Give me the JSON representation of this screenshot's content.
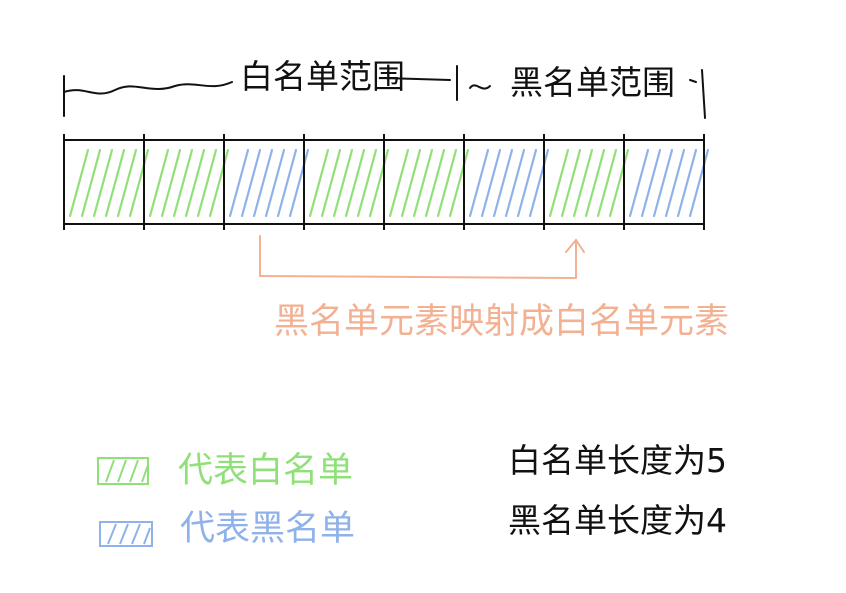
{
  "top_labels": {
    "whitelist_range": "白名单范围",
    "blacklist_range": "黑名单范围"
  },
  "cells": [
    {
      "kind": "white"
    },
    {
      "kind": "white"
    },
    {
      "kind": "black"
    },
    {
      "kind": "white"
    },
    {
      "kind": "white"
    },
    {
      "kind": "black"
    },
    {
      "kind": "white"
    },
    {
      "kind": "black"
    }
  ],
  "mapping_label": "黑名单元素映射成白名单元素",
  "legend": [
    {
      "label": "代表白名单",
      "color": "#90e07a"
    },
    {
      "label": "代表黑名单",
      "color": "#8fb2ea"
    }
  ],
  "notes": [
    "白名单长度为5",
    "黑名单长度为4"
  ],
  "colors": {
    "white_cell": "#90e07a",
    "black_cell": "#8fb2ea",
    "mapping": "#f3b193",
    "ink": "#111111"
  }
}
